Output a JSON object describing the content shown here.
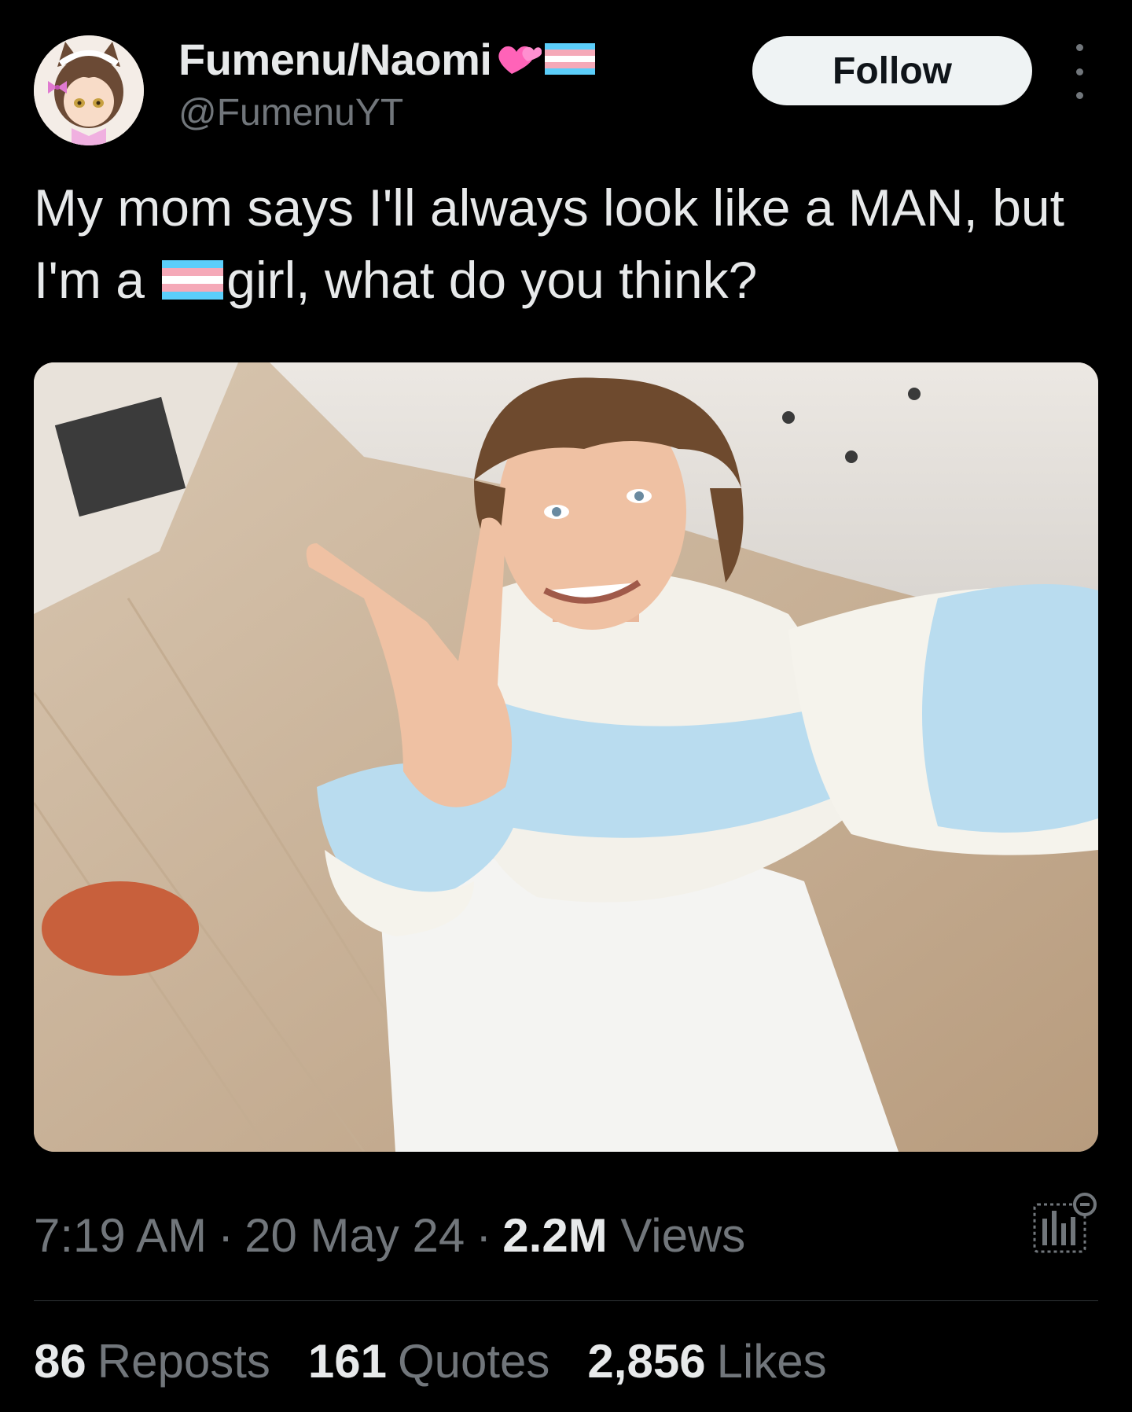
{
  "author": {
    "display_name": "Fumenu/Naomi",
    "handle": "@FumenuYT",
    "name_emojis": [
      "two-hearts-emoji",
      "transgender-flag-emoji"
    ]
  },
  "actions": {
    "follow_label": "Follow",
    "more_icon": "more-options-icon"
  },
  "tweet": {
    "text_part1": "My mom says I'll always look like a MAN, but I'm a ",
    "inline_emoji": "transgender-flag-emoji",
    "text_part2": "girl, what do you think?"
  },
  "meta": {
    "time": "7:19 AM",
    "date": "20 May 24",
    "separator": "·",
    "views_count": "2.2M",
    "views_label": "Views",
    "analytics_icon": "analytics-icon"
  },
  "stats": {
    "reposts_count": "86",
    "reposts_label": "Reposts",
    "quotes_count": "161",
    "quotes_label": "Quotes",
    "likes_count": "2,856",
    "likes_label": "Likes"
  },
  "colors": {
    "background": "#000000",
    "primary_text": "#e7e9ea",
    "secondary_text": "#71767b",
    "follow_button_bg": "#eff3f4",
    "divider": "#2f3336",
    "trans_blue": "#5bcefa",
    "trans_pink": "#f5a9b8",
    "trans_white": "#ffffff"
  }
}
